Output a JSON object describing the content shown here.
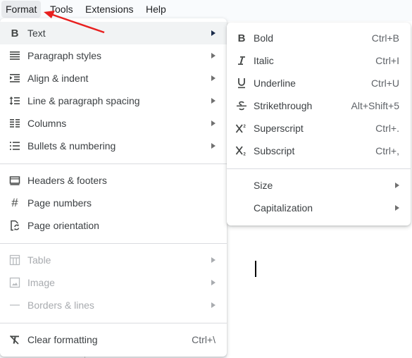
{
  "menubar": {
    "items": [
      {
        "label": "Format"
      },
      {
        "label": "Tools"
      },
      {
        "label": "Extensions"
      },
      {
        "label": "Help"
      }
    ]
  },
  "format_menu": {
    "groups": [
      [
        {
          "label": "Text",
          "icon": "bold-icon",
          "submenu": true
        },
        {
          "label": "Paragraph styles",
          "icon": "paragraph-styles-icon",
          "submenu": true
        },
        {
          "label": "Align & indent",
          "icon": "align-indent-icon",
          "submenu": true
        },
        {
          "label": "Line & paragraph spacing",
          "icon": "line-spacing-icon",
          "submenu": true
        },
        {
          "label": "Columns",
          "icon": "columns-icon",
          "submenu": true
        },
        {
          "label": "Bullets & numbering",
          "icon": "bullets-icon",
          "submenu": true
        }
      ],
      [
        {
          "label": "Headers & footers",
          "icon": "headers-footers-icon"
        },
        {
          "label": "Page numbers",
          "icon": "hash-icon"
        },
        {
          "label": "Page orientation",
          "icon": "page-orientation-icon"
        }
      ],
      [
        {
          "label": "Table",
          "icon": "table-icon",
          "submenu": true,
          "disabled": true
        },
        {
          "label": "Image",
          "icon": "image-icon",
          "submenu": true,
          "disabled": true
        },
        {
          "label": "Borders & lines",
          "icon": "borders-lines-icon",
          "submenu": true,
          "disabled": true
        }
      ],
      [
        {
          "label": "Clear formatting",
          "icon": "clear-formatting-icon",
          "shortcut": "Ctrl+\\"
        }
      ]
    ]
  },
  "text_submenu": {
    "items": [
      {
        "label": "Bold",
        "icon": "bold-icon",
        "shortcut": "Ctrl+B"
      },
      {
        "label": "Italic",
        "icon": "italic-icon",
        "shortcut": "Ctrl+I"
      },
      {
        "label": "Underline",
        "icon": "underline-icon",
        "shortcut": "Ctrl+U"
      },
      {
        "label": "Strikethrough",
        "icon": "strikethrough-icon",
        "shortcut": "Alt+Shift+5"
      },
      {
        "label": "Superscript",
        "icon": "superscript-icon",
        "shortcut": "Ctrl+."
      },
      {
        "label": "Subscript",
        "icon": "subscript-icon",
        "shortcut": "Ctrl+,"
      }
    ],
    "more": [
      {
        "label": "Size",
        "submenu": true
      },
      {
        "label": "Capitalization",
        "submenu": true
      }
    ]
  },
  "colors": {
    "annotation_arrow": "#e8201f",
    "hover_bg": "#f1f3f4",
    "disabled_text": "#a8abaf"
  }
}
